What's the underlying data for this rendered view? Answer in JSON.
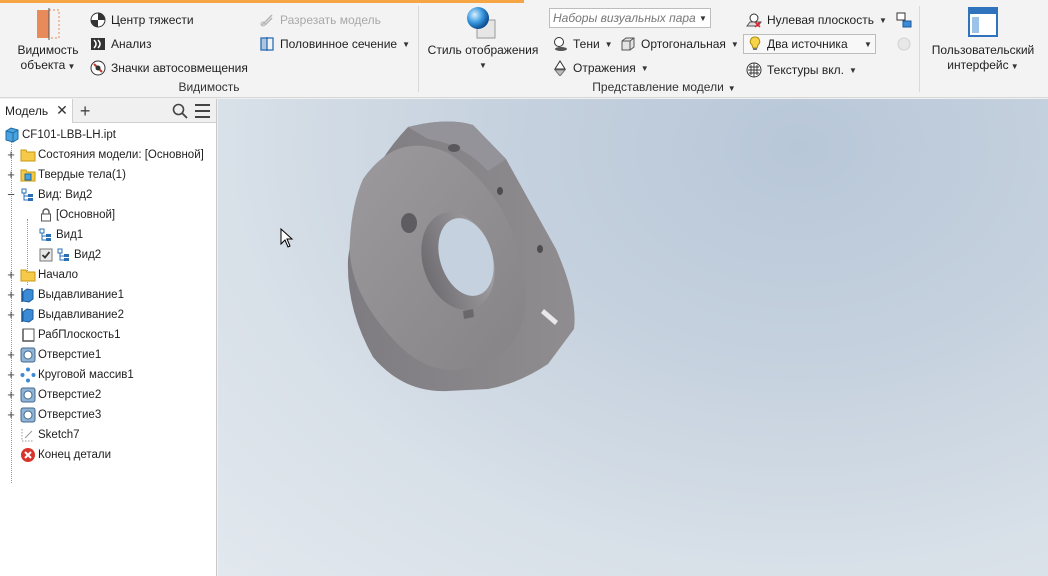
{
  "colors": {
    "accent": "#f5a544",
    "viewport_top": "#b8c7d8",
    "viewport_bottom": "#e2e8ee",
    "part": "#8b898c"
  },
  "ribbon": {
    "visibility_group": {
      "object_visibility_line1": "Видимость",
      "object_visibility_line2": "объекта",
      "center_of_gravity": "Центр тяжести",
      "analysis": "Анализ",
      "autosnap_icons": "Значки автосовмещения",
      "cut_model": "Разрезать модель",
      "half_section": "Половинное сечение",
      "label": "Видимость"
    },
    "model_display_group": {
      "display_style": "Стиль отображения",
      "visual_sets_placeholder": "Наборы визуальных пара",
      "shadows": "Тени",
      "orthographic": "Ортогональная",
      "reflections": "Отражения",
      "ground_plane": "Нулевая плоскость",
      "two_lights": "Два источника",
      "textures_on": "Текстуры вкл.",
      "label": "Представление модели"
    },
    "custom_ui": {
      "line1": "Пользовательский",
      "line2": "интерфейс"
    }
  },
  "browser": {
    "tab_label": "Модель",
    "items": [
      {
        "label": "CF101-LBB-LH.ipt",
        "icon": "part-file-icon"
      },
      {
        "label": "Состояния модели: [Основной]",
        "icon": "folder-icon"
      },
      {
        "label": "Твердые тела(1)",
        "icon": "solid-bodies-folder-icon"
      },
      {
        "label": "Вид: Вид2",
        "icon": "view-icon"
      },
      {
        "label": "[Основной]",
        "icon": "lock-icon"
      },
      {
        "label": "Вид1",
        "icon": "view-icon"
      },
      {
        "label": "Вид2",
        "icon": "view-icon"
      },
      {
        "label": "Начало",
        "icon": "folder-icon"
      },
      {
        "label": "Выдавливание1",
        "icon": "extrude-icon"
      },
      {
        "label": "Выдавливание2",
        "icon": "extrude-icon"
      },
      {
        "label": "РабПлоскость1",
        "icon": "work-plane-icon"
      },
      {
        "label": "Отверстие1",
        "icon": "hole-icon"
      },
      {
        "label": "Круговой массив1",
        "icon": "circular-pattern-icon"
      },
      {
        "label": "Отверстие2",
        "icon": "hole-icon"
      },
      {
        "label": "Отверстие3",
        "icon": "hole-icon"
      },
      {
        "label": "Sketch7",
        "icon": "sketch-icon"
      },
      {
        "label": "Конец детали",
        "icon": "end-of-part-icon"
      }
    ]
  }
}
